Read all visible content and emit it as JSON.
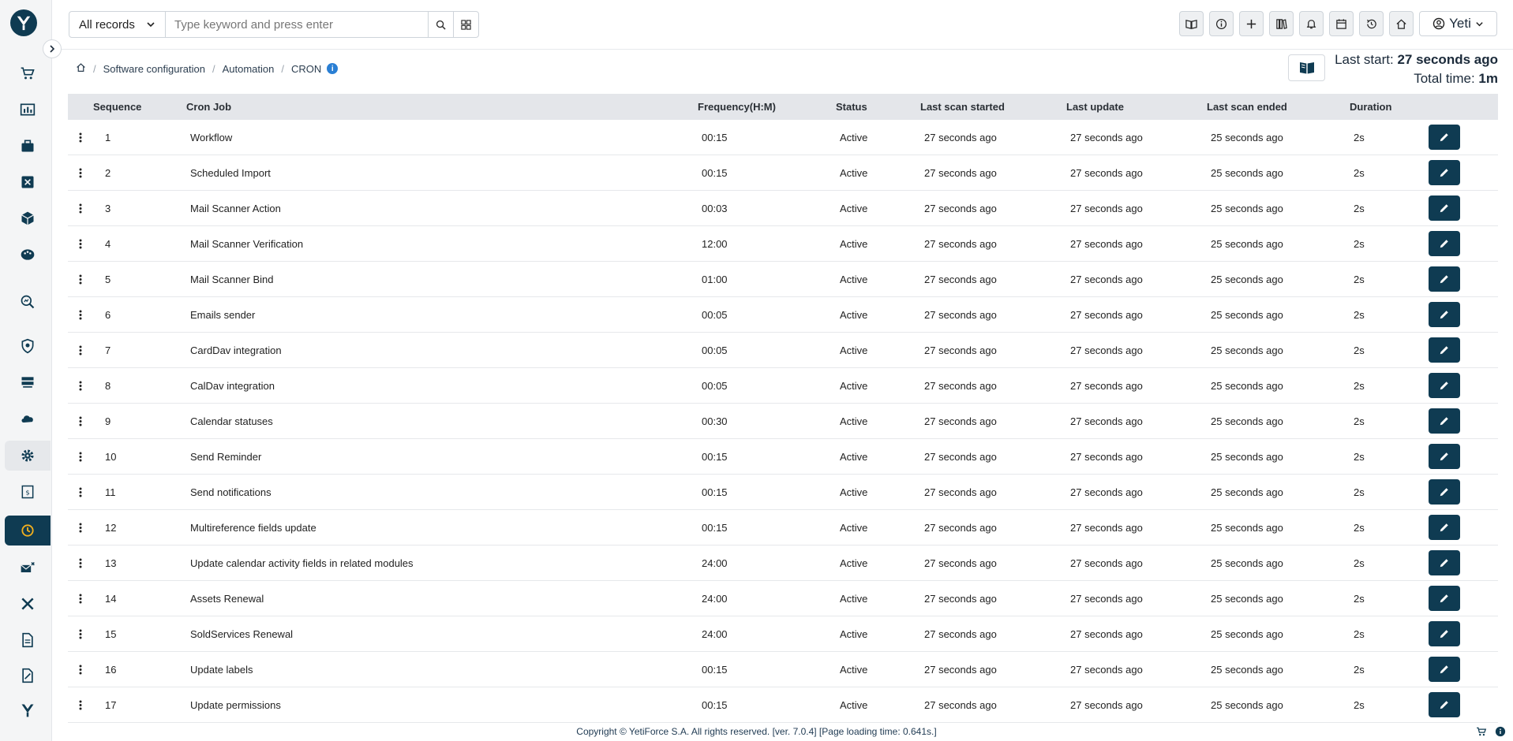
{
  "header": {
    "module_select": "All records",
    "search_placeholder": "Type keyword and press enter",
    "user_name": "Yeti"
  },
  "breadcrumb": [
    "Software configuration",
    "Automation",
    "CRON"
  ],
  "summary": {
    "last_start_label": "Last start:",
    "last_start_value": "27 seconds ago",
    "total_time_label": "Total time:",
    "total_time_value": "1m"
  },
  "table": {
    "columns": [
      "Sequence",
      "Cron Job",
      "Frequency(H:M)",
      "Status",
      "Last scan started",
      "Last update",
      "Last scan ended",
      "Duration"
    ],
    "rows": [
      {
        "seq": "1",
        "name": "Workflow",
        "freq": "00:15",
        "status": "Active",
        "started": "27 seconds ago",
        "updated": "27 seconds ago",
        "ended": "25 seconds ago",
        "duration": "2s"
      },
      {
        "seq": "2",
        "name": "Scheduled Import",
        "freq": "00:15",
        "status": "Active",
        "started": "27 seconds ago",
        "updated": "27 seconds ago",
        "ended": "25 seconds ago",
        "duration": "2s"
      },
      {
        "seq": "3",
        "name": "Mail Scanner Action",
        "freq": "00:03",
        "status": "Active",
        "started": "27 seconds ago",
        "updated": "27 seconds ago",
        "ended": "25 seconds ago",
        "duration": "2s"
      },
      {
        "seq": "4",
        "name": "Mail Scanner Verification",
        "freq": "12:00",
        "status": "Active",
        "started": "27 seconds ago",
        "updated": "27 seconds ago",
        "ended": "25 seconds ago",
        "duration": "2s"
      },
      {
        "seq": "5",
        "name": "Mail Scanner Bind",
        "freq": "01:00",
        "status": "Active",
        "started": "27 seconds ago",
        "updated": "27 seconds ago",
        "ended": "25 seconds ago",
        "duration": "2s"
      },
      {
        "seq": "6",
        "name": "Emails sender",
        "freq": "00:05",
        "status": "Active",
        "started": "27 seconds ago",
        "updated": "27 seconds ago",
        "ended": "25 seconds ago",
        "duration": "2s"
      },
      {
        "seq": "7",
        "name": "CardDav integration",
        "freq": "00:05",
        "status": "Active",
        "started": "27 seconds ago",
        "updated": "27 seconds ago",
        "ended": "25 seconds ago",
        "duration": "2s"
      },
      {
        "seq": "8",
        "name": "CalDav integration",
        "freq": "00:05",
        "status": "Active",
        "started": "27 seconds ago",
        "updated": "27 seconds ago",
        "ended": "25 seconds ago",
        "duration": "2s"
      },
      {
        "seq": "9",
        "name": "Calendar statuses",
        "freq": "00:30",
        "status": "Active",
        "started": "27 seconds ago",
        "updated": "27 seconds ago",
        "ended": "25 seconds ago",
        "duration": "2s"
      },
      {
        "seq": "10",
        "name": "Send Reminder",
        "freq": "00:15",
        "status": "Active",
        "started": "27 seconds ago",
        "updated": "27 seconds ago",
        "ended": "25 seconds ago",
        "duration": "2s"
      },
      {
        "seq": "11",
        "name": "Send notifications",
        "freq": "00:15",
        "status": "Active",
        "started": "27 seconds ago",
        "updated": "27 seconds ago",
        "ended": "25 seconds ago",
        "duration": "2s"
      },
      {
        "seq": "12",
        "name": "Multireference fields update",
        "freq": "00:15",
        "status": "Active",
        "started": "27 seconds ago",
        "updated": "27 seconds ago",
        "ended": "25 seconds ago",
        "duration": "2s"
      },
      {
        "seq": "13",
        "name": "Update calendar activity fields in related modules",
        "freq": "24:00",
        "status": "Active",
        "started": "27 seconds ago",
        "updated": "27 seconds ago",
        "ended": "25 seconds ago",
        "duration": "2s"
      },
      {
        "seq": "14",
        "name": "Assets Renewal",
        "freq": "24:00",
        "status": "Active",
        "started": "27 seconds ago",
        "updated": "27 seconds ago",
        "ended": "25 seconds ago",
        "duration": "2s"
      },
      {
        "seq": "15",
        "name": "SoldServices Renewal",
        "freq": "24:00",
        "status": "Active",
        "started": "27 seconds ago",
        "updated": "27 seconds ago",
        "ended": "25 seconds ago",
        "duration": "2s"
      },
      {
        "seq": "16",
        "name": "Update labels",
        "freq": "00:15",
        "status": "Active",
        "started": "27 seconds ago",
        "updated": "27 seconds ago",
        "ended": "25 seconds ago",
        "duration": "2s"
      },
      {
        "seq": "17",
        "name": "Update permissions",
        "freq": "00:15",
        "status": "Active",
        "started": "27 seconds ago",
        "updated": "27 seconds ago",
        "ended": "25 seconds ago",
        "duration": "2s"
      }
    ]
  },
  "footer": {
    "text": "Copyright © YetiForce S.A. All rights reserved. [ver. 7.0.4] [Page loading time: 0.641s.]"
  },
  "colors": {
    "primary": "#0f3b52",
    "accent_yellow": "#f2b01e",
    "info_blue": "#2a7fd4",
    "table_header": "#e4e6ea"
  },
  "icons": {
    "sidebar": [
      "cart-icon",
      "chart-icon",
      "briefcase-icon",
      "puzzle-icon",
      "cube-icon",
      "palette-icon",
      "search-chart-icon",
      "shield-icon",
      "server-icon",
      "cloud-icon",
      "gear-icon",
      "invoice-icon",
      "clock-icon",
      "mail-remove-icon",
      "tools-icon",
      "document-icon",
      "contract-icon",
      "yeti-icon"
    ],
    "header": [
      "book-icon",
      "info-icon",
      "plus-icon",
      "library-icon",
      "bell-icon",
      "calendar-icon",
      "history-icon",
      "home-icon"
    ]
  }
}
